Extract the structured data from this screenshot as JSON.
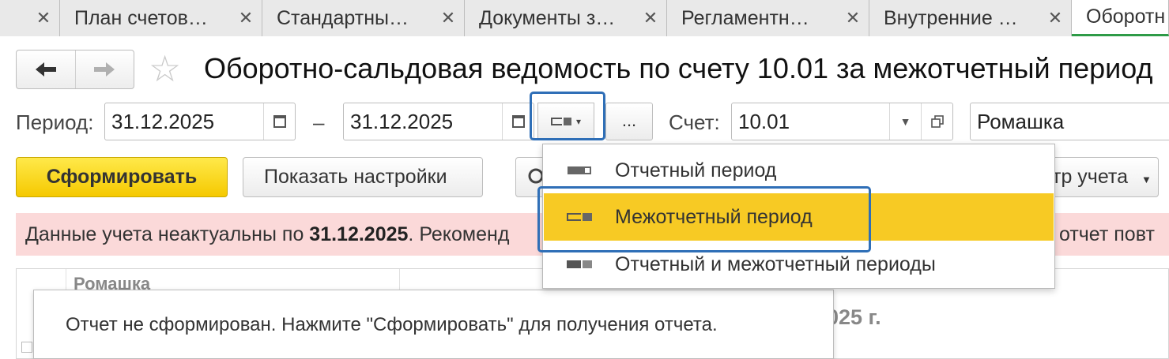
{
  "tabs": [
    {
      "label": "",
      "close": "✕"
    },
    {
      "label": "План счетов…",
      "close": "✕"
    },
    {
      "label": "Стандартны…",
      "close": "✕"
    },
    {
      "label": "Документы з…",
      "close": "✕"
    },
    {
      "label": "Регламентн…",
      "close": "✕"
    },
    {
      "label": "Внутренние …",
      "close": "✕"
    },
    {
      "label": "Оборотн",
      "close": ""
    }
  ],
  "header": {
    "back_icon": "arrow-left-icon",
    "forward_icon": "arrow-right-icon",
    "favorite_icon": "star-icon",
    "title": "Оборотно-сальдовая ведомость по счету 10.01 за межотчетный период"
  },
  "period": {
    "label": "Период:",
    "from": "31.12.2025",
    "separator": "–",
    "to": "31.12.2025",
    "more_label": "...",
    "account_label": "Счет:",
    "account_value": "10.01",
    "organization_value": "Ромашка"
  },
  "toolbar": {
    "generate_label": "Сформировать",
    "settings_label": "Показать настройки",
    "accounting_label": "тр учета"
  },
  "warning": {
    "prefix": "Данные учета неактуальны по ",
    "date": "31.12.2025",
    "suffix": ". Рекоменд",
    "tail": "ь отчет повт"
  },
  "report": {
    "organization": "Ромашка",
    "year_fragment": "025 г.",
    "message": "Отчет не сформирован. Нажмите \"Сформировать\" для получения отчета."
  },
  "period_kind_menu": {
    "items": [
      {
        "label": "Отчетный период",
        "selected": false
      },
      {
        "label": "Межотчетный период",
        "selected": true
      },
      {
        "label": "Отчетный и межотчетный периоды",
        "selected": false
      }
    ]
  },
  "colors": {
    "accent_green": "#2e9b47",
    "highlight_blue": "#2f6fb7",
    "selected_yellow": "#f7ca24",
    "warning_bg": "#fbd9d9"
  }
}
